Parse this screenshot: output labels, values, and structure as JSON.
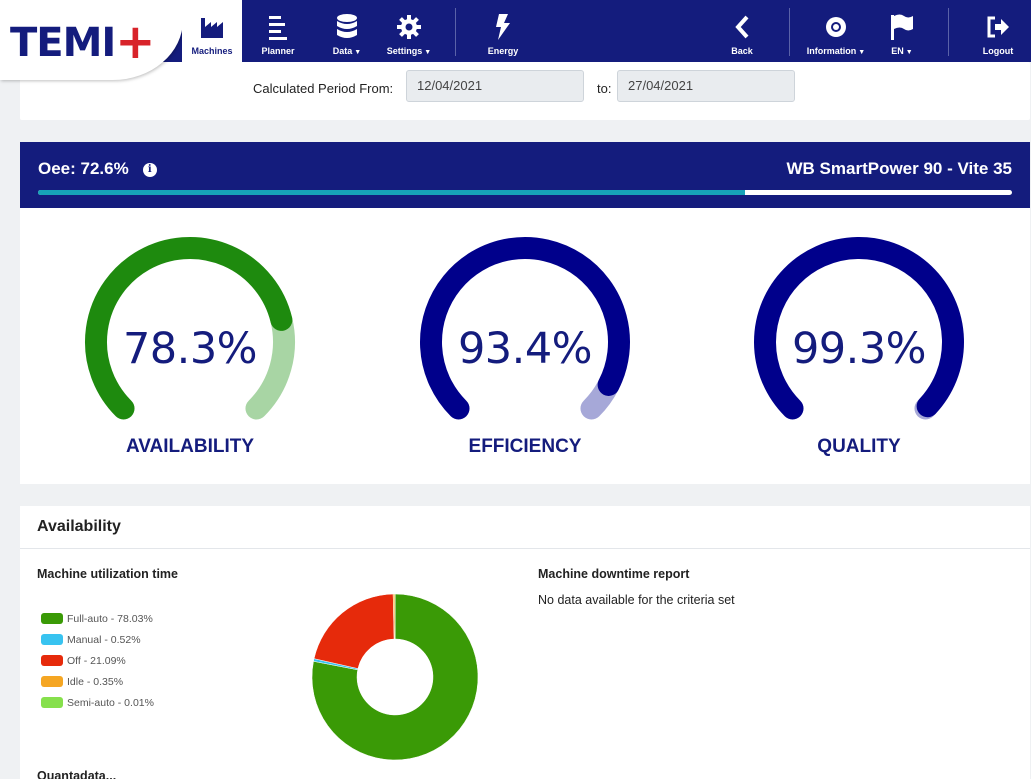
{
  "brand": {
    "logo_text": "TEMI",
    "logo_plus": "+"
  },
  "nav": {
    "machines": "Machines",
    "planner": "Planner",
    "data": "Data",
    "settings": "Settings",
    "energy": "Energy",
    "back": "Back",
    "information": "Information",
    "language": "EN",
    "logout": "Logout"
  },
  "period": {
    "from_label": "Calculated Period From:",
    "from_value": "12/04/2021",
    "to_label": "to:",
    "to_value": "27/04/2021"
  },
  "oee": {
    "title": "Oee: 72.6%",
    "info_icon": "i",
    "value_percent": 72.6,
    "machine": "WB SmartPower 90 - Vite 35",
    "bar_color": "#17a2b8"
  },
  "gauges": [
    {
      "label": "AVAILABILITY",
      "value_text": "78.3%",
      "value": 78.3,
      "main_color": "#1e8a0e",
      "rest_color": "#a8d5a4"
    },
    {
      "label": "EFFICIENCY",
      "value_text": "93.4%",
      "value": 93.4,
      "main_color": "#00008b",
      "rest_color": "#a6a8d8"
    },
    {
      "label": "QUALITY",
      "value_text": "99.3%",
      "value": 99.3,
      "main_color": "#00008b",
      "rest_color": "#a6a8d8"
    }
  ],
  "availability": {
    "title": "Availability",
    "utilization_title": "Machine utilization time",
    "downtime_title": "Machine downtime report",
    "downtime_empty": "No data available for the criteria set",
    "next_section": "Quantadata..."
  },
  "chart_data": {
    "type": "pie",
    "title": "Machine utilization time",
    "legend_position": "left",
    "series": [
      {
        "name": "Full-auto",
        "label": "Full-auto - 78.03%",
        "value": 78.03,
        "color": "#3a9a06"
      },
      {
        "name": "Manual",
        "label": "Manual - 0.52%",
        "value": 0.52,
        "color": "#38c3f0"
      },
      {
        "name": "Off",
        "label": "Off - 21.09%",
        "value": 21.09,
        "color": "#e62a0b"
      },
      {
        "name": "Idle",
        "label": "Idle - 0.35%",
        "value": 0.35,
        "color": "#f5a623"
      },
      {
        "name": "Semi-auto",
        "label": "Semi-auto - 0.01%",
        "value": 0.01,
        "color": "#86e04c"
      }
    ]
  }
}
